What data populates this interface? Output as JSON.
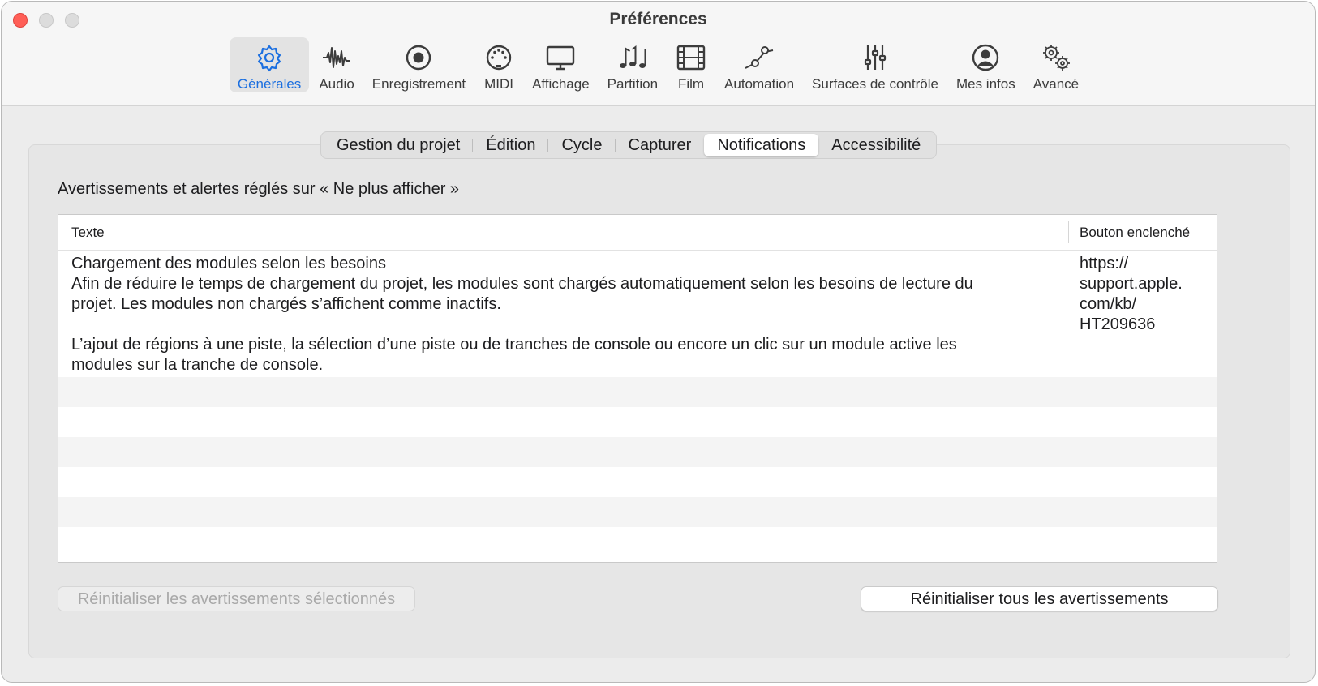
{
  "window": {
    "title": "Préférences",
    "accent": "#1b6fe0"
  },
  "toolbar": {
    "items": [
      {
        "label": "Générales",
        "icon": "gear-icon",
        "active": true
      },
      {
        "label": "Audio",
        "icon": "waveform-icon"
      },
      {
        "label": "Enregistrement",
        "icon": "record-icon"
      },
      {
        "label": "MIDI",
        "icon": "midi-icon"
      },
      {
        "label": "Affichage",
        "icon": "display-icon"
      },
      {
        "label": "Partition",
        "icon": "music-notes-icon"
      },
      {
        "label": "Film",
        "icon": "film-icon"
      },
      {
        "label": "Automation",
        "icon": "automation-icon"
      },
      {
        "label": "Surfaces de contrôle",
        "icon": "sliders-icon"
      },
      {
        "label": "Mes infos",
        "icon": "person-icon"
      },
      {
        "label": "Avancé",
        "icon": "gears-icon"
      }
    ]
  },
  "tabs": [
    {
      "label": "Gestion du projet"
    },
    {
      "label": "Édition"
    },
    {
      "label": "Cycle"
    },
    {
      "label": "Capturer"
    },
    {
      "label": "Notifications",
      "active": true
    },
    {
      "label": "Accessibilité"
    }
  ],
  "section": {
    "label": "Avertissements et alertes réglés sur « Ne plus afficher »"
  },
  "table": {
    "columns": [
      "Texte",
      "Bouton enclenché"
    ],
    "rows": [
      {
        "text_lines": [
          "Chargement des modules selon les besoins",
          "Afin de réduire le temps de chargement du projet, les modules sont chargés automatiquement selon les besoins de lecture du",
          "projet. Les modules non chargés s’affichent comme inactifs.",
          "L’ajout de régions à une piste, la sélection d’une piste ou de tranches de console ou encore un clic sur un module active les",
          "modules sur la tranche de console."
        ],
        "button_lines": [
          "https://",
          "support.apple.",
          "com/kb/",
          "HT209636"
        ]
      }
    ]
  },
  "buttons": {
    "reset_selected": "Réinitialiser les avertissements sélectionnés",
    "reset_all": "Réinitialiser tous les avertissements"
  }
}
